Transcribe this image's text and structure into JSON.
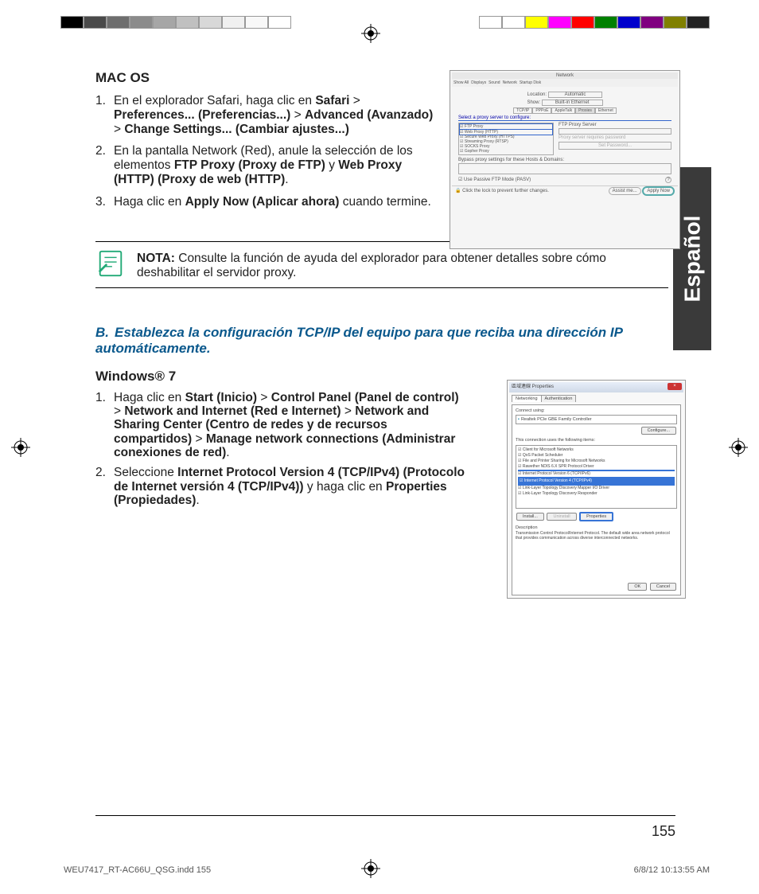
{
  "language_tab": "Español",
  "macos": {
    "heading": "MAC OS",
    "steps": [
      {
        "num": "1.",
        "segments": [
          {
            "t": "En el explorador Safari, haga clic en ",
            "b": false
          },
          {
            "t": "Safari",
            "b": true
          },
          {
            "t": " > ",
            "b": false
          },
          {
            "t": "Preferences... (Preferencias...)",
            "b": true
          },
          {
            "t": " > ",
            "b": false
          },
          {
            "t": "Advanced (Avanzado)",
            "b": true
          },
          {
            "t": " > ",
            "b": false
          },
          {
            "t": "Change Settings... (Cambiar ajustes...)",
            "b": true
          }
        ]
      },
      {
        "num": "2.",
        "segments": [
          {
            "t": "En la pantalla Network (Red), anule la selección de los elementos ",
            "b": false
          },
          {
            "t": "FTP Proxy (Proxy de FTP)",
            "b": true
          },
          {
            "t": " y ",
            "b": false
          },
          {
            "t": "Web Proxy (HTTP) (Proxy de web (HTTP)",
            "b": true
          },
          {
            "t": ".",
            "b": false
          }
        ]
      },
      {
        "num": "3.",
        "segments": [
          {
            "t": "Haga clic en ",
            "b": false
          },
          {
            "t": "Apply Now (Aplicar ahora)",
            "b": true
          },
          {
            "t": " cuando termine.",
            "b": false
          }
        ]
      }
    ],
    "screenshot": {
      "title": "Network",
      "toolbar": [
        "Show All",
        "Displays",
        "Sound",
        "Network",
        "Startup Disk"
      ],
      "location_label": "Location:",
      "location_value": "Automatic",
      "show_label": "Show:",
      "show_value": "Built-in Ethernet",
      "tabs": [
        "TCP/IP",
        "PPPoE",
        "AppleTalk",
        "Proxies",
        "Ethernet"
      ],
      "select_proxy": "Select a proxy server to configure:",
      "proxies": [
        "FTP Proxy",
        "Web Proxy (HTTP)",
        "Secure Web Proxy (HTTPS)",
        "Streaming Proxy (RTSP)",
        "SOCKS Proxy",
        "Gopher Proxy"
      ],
      "ftp_server_label": "FTP Proxy Server",
      "requires_pwd": "Proxy server requires password",
      "set_pwd": "Set Password...",
      "bypass": "Bypass proxy settings for these Hosts & Domains:",
      "pasv": "Use Passive FTP Mode (PASV)",
      "lock": "Click the lock to prevent further changes.",
      "assist": "Assist me...",
      "apply": "Apply Now"
    }
  },
  "note": {
    "label": "NOTA:",
    "text": " Consulte la función de ayuda del explorador para obtener detalles sobre cómo deshabilitar el servidor proxy."
  },
  "section_b": {
    "letter": "B.",
    "title": "Establezca la configuración TCP/IP del equipo para que reciba una dirección IP automáticamente."
  },
  "win7": {
    "heading": "Windows® 7",
    "steps": [
      {
        "num": "1.",
        "segments": [
          {
            "t": "Haga clic en ",
            "b": false
          },
          {
            "t": "Start (Inicio)",
            "b": true
          },
          {
            "t": " > ",
            "b": false
          },
          {
            "t": "Control Panel (Panel de control)",
            "b": true
          },
          {
            "t": " > ",
            "b": false
          },
          {
            "t": "Network and Internet (Red e Internet)",
            "b": true
          },
          {
            "t": " > ",
            "b": false
          },
          {
            "t": "Network and Sharing Center (Centro de redes y de recursos compartidos)",
            "b": true
          },
          {
            "t": " > ",
            "b": false
          },
          {
            "t": "Manage network connections (Administrar conexiones de red)",
            "b": true
          },
          {
            "t": ".",
            "b": false
          }
        ]
      },
      {
        "num": "2.",
        "segments": [
          {
            "t": "Seleccione ",
            "b": false
          },
          {
            "t": "Internet Protocol Version 4 (TCP/IPv4) (Protocolo de Internet versión 4 (TCP/IPv4))",
            "b": true
          },
          {
            "t": " y haga clic en ",
            "b": false
          },
          {
            "t": "Properties (Propiedades)",
            "b": true
          },
          {
            "t": ".",
            "b": false
          }
        ]
      }
    ],
    "screenshot": {
      "title": "區域連線 Properties",
      "tabs": [
        "Networking",
        "Authentication"
      ],
      "connect_using": "Connect using:",
      "adapter": "Realtek PCIe GBE Family Controller",
      "configure": "Configure...",
      "uses_items": "This connection uses the following items:",
      "items": [
        "Client for Microsoft Networks",
        "QoS Packet Scheduler",
        "File and Printer Sharing for Microsoft Networks",
        "Rawether NDIS 6.X SPR Protocol Driver",
        "Internet Protocol Version 6 (TCP/IPv6)",
        "Internet Protocol Version 4 (TCP/IPv4)",
        "Link-Layer Topology Discovery Mapper I/O Driver",
        "Link-Layer Topology Discovery Responder"
      ],
      "install": "Install...",
      "uninstall": "Uninstall",
      "properties": "Properties",
      "desc_label": "Description",
      "desc": "Transmission Control Protocol/Internet Protocol. The default wide area network protocol that provides communication across diverse interconnected networks.",
      "ok": "OK",
      "cancel": "Cancel"
    }
  },
  "page_number": "155",
  "footer": {
    "file": "WEU7417_RT-AC66U_QSG.indd   155",
    "date": "6/8/12   10:13:55 AM"
  },
  "colorbar_left": [
    "#000000",
    "#4a4a4a",
    "#6e6e6e",
    "#8b8b8b",
    "#a6a6a6",
    "#c0c0c0",
    "#d8d8d8",
    "#f0f0f0",
    "#f8f8f8",
    "#ffffff"
  ],
  "colorbar_right": [
    "#ffffff",
    "#ffffff",
    "#ffff00",
    "#ff00ff",
    "#ff0000",
    "#008000",
    "#0000cc",
    "#800080",
    "#808000",
    "#222222"
  ]
}
